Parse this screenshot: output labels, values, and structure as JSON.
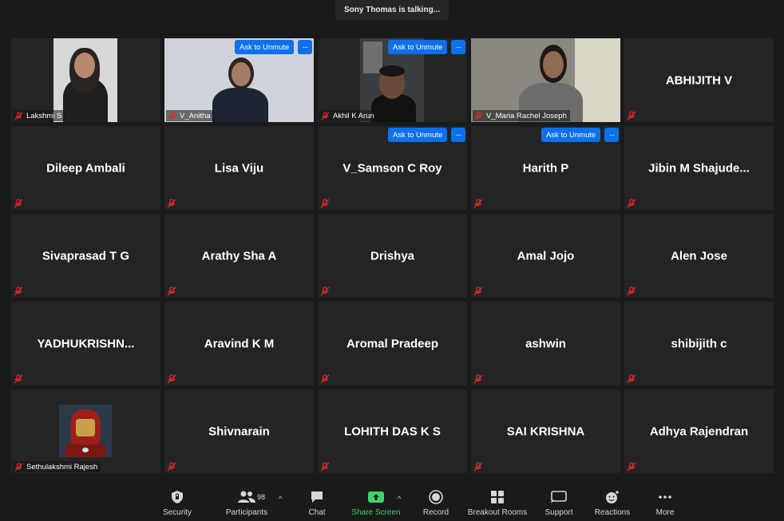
{
  "status": {
    "talking": "Sony Thomas is talking..."
  },
  "participants": [
    {
      "name": "Lakshmi S",
      "video": true
    },
    {
      "name": "V_Anitha",
      "video": true,
      "unmute": true
    },
    {
      "name": "Akhil K Arun",
      "video": true,
      "unmute": true
    },
    {
      "name": "V_Maria Rachel Joseph",
      "video": true
    },
    {
      "name": "ABHIJITH V"
    },
    {
      "name": "Dileep Ambali"
    },
    {
      "name": "Lisa Viju"
    },
    {
      "name": "V_Samson C Roy",
      "unmute": true
    },
    {
      "name": "Harith P",
      "unmute": true
    },
    {
      "name": "Jibin  M  Shajude..."
    },
    {
      "name": "Sivaprasad T G"
    },
    {
      "name": "Arathy Sha A"
    },
    {
      "name": "Drishya"
    },
    {
      "name": "Amal Jojo"
    },
    {
      "name": "Alen Jose"
    },
    {
      "name": "YADHUKRISHN..."
    },
    {
      "name": "Aravind K M"
    },
    {
      "name": "Aromal Pradeep"
    },
    {
      "name": "ashwin"
    },
    {
      "name": "shibijith c"
    },
    {
      "name": "Sethulakshmi Rajesh",
      "video": true
    },
    {
      "name": "Shivnarain"
    },
    {
      "name": "LOHITH DAS K S"
    },
    {
      "name": "SAI KRISHNA"
    },
    {
      "name": "Adhya Rajendran"
    }
  ],
  "unmute_label": "Ask to Unmute",
  "more_dots": "···",
  "toolbar": {
    "security": "Security",
    "participants": "Participants",
    "participants_count": "98",
    "chat": "Chat",
    "share_screen": "Share Screen",
    "record": "Record",
    "breakout": "Breakout Rooms",
    "support": "Support",
    "reactions": "Reactions",
    "more": "More",
    "caret": "^"
  },
  "colors": {
    "accent": "#0e71eb",
    "share": "#3fd36e",
    "mute": "#e02828",
    "tile": "#242424"
  }
}
